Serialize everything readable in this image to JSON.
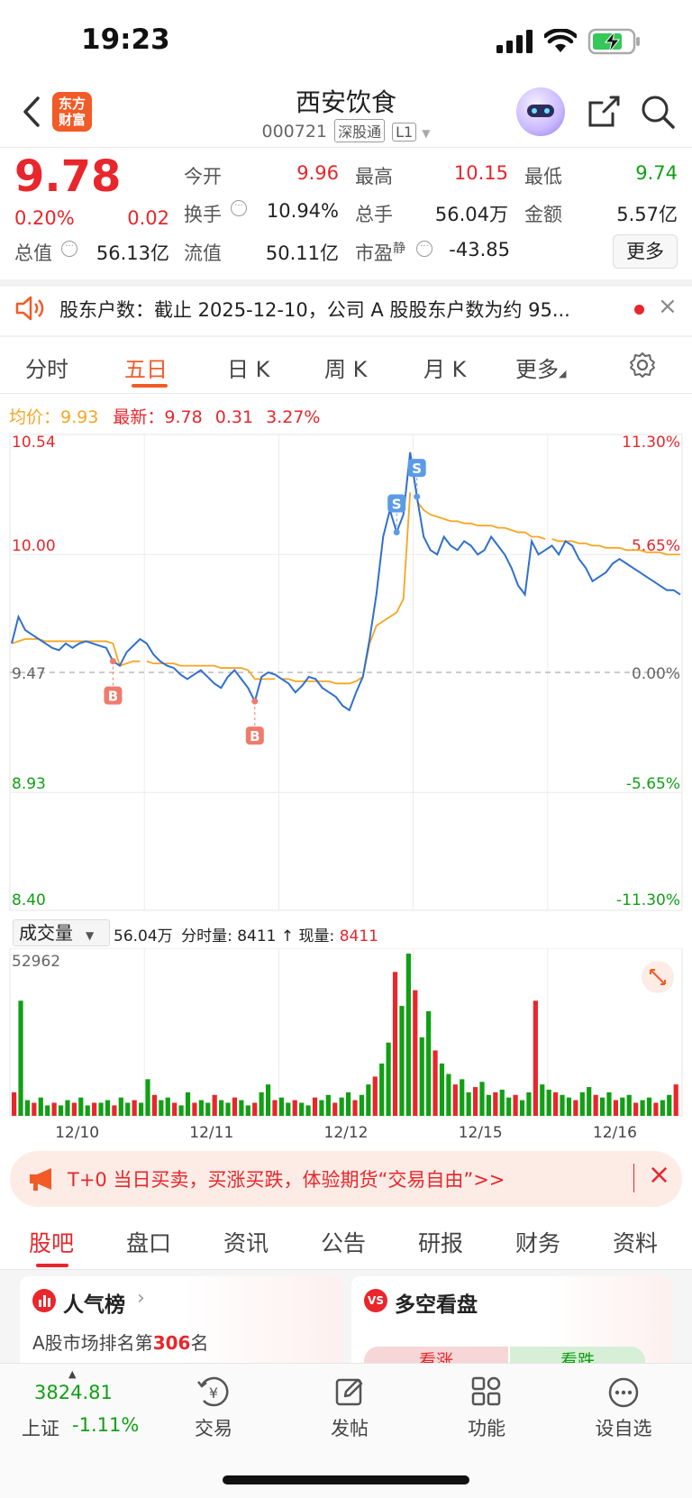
{
  "status_bar": {
    "time": "19:23"
  },
  "header": {
    "logo_text": "东方财富",
    "title": "西安饮食",
    "code": "000721",
    "tag1": "深股通",
    "tag2": "L1"
  },
  "quote": {
    "price": "9.78",
    "change_pct": "0.20%",
    "change": "0.02",
    "open_label": "今开",
    "open": "9.96",
    "high_label": "最高",
    "high": "10.15",
    "low_label": "最低",
    "low": "9.74",
    "turnover_label": "换手",
    "turnover": "10.94%",
    "volume_label": "总手",
    "volume": "56.04万",
    "amount_label": "金额",
    "amount": "5.57亿",
    "mcap_label": "总值",
    "mcap": "56.13亿",
    "float_label": "流值",
    "float": "50.11亿",
    "pe_label": "市盈",
    "pe_sup": "静",
    "pe": "-43.85",
    "more_label": "更多"
  },
  "notice": {
    "text": "股东户数：截止 2025-12-10，公司 A 股股东户数为约 95..."
  },
  "chart_tabs": [
    "分时",
    "五日",
    "日 K",
    "周 K",
    "月 K",
    "更多"
  ],
  "active_chart_tab": "五日",
  "chart_header": {
    "avg_label": "均价：",
    "avg": "9.93",
    "latest_label": "最新：",
    "latest": "9.78",
    "chg": "0.31",
    "chg_pct": "3.27%"
  },
  "chart_data": {
    "type": "line",
    "title": "",
    "y_ticks_left": [
      "10.54",
      "10.00",
      "9.47",
      "8.93",
      "8.40"
    ],
    "y_ticks_right": [
      "11.30%",
      "5.65%",
      "0.00%",
      "-5.65%",
      "-11.30%"
    ],
    "ylim": [
      8.4,
      10.54
    ],
    "prev_close": 9.47,
    "x_labels": [
      "12/10",
      "12/11",
      "12/12",
      "12/15",
      "12/16"
    ],
    "series": [
      {
        "values": [
          9.6,
          9.72,
          9.66,
          9.64,
          9.62,
          9.6,
          9.58,
          9.57,
          9.6,
          9.58,
          9.6,
          9.61,
          9.6,
          9.59,
          9.58,
          9.52,
          9.5,
          9.56,
          9.59,
          9.62,
          9.6,
          9.55,
          9.52,
          9.5,
          9.49,
          9.46,
          9.44,
          9.46,
          9.48,
          9.45,
          9.42,
          9.4,
          9.45,
          9.48,
          9.44,
          9.4,
          9.34,
          9.45,
          9.47,
          9.46,
          9.44,
          9.42,
          9.38,
          9.41,
          9.45,
          9.44,
          9.4,
          9.38,
          9.36,
          9.32,
          9.3,
          9.38,
          9.45,
          9.62,
          9.82,
          10.08,
          10.2,
          10.1,
          10.18,
          10.46,
          10.26,
          10.08,
          10.02,
          10.0,
          10.08,
          10.04,
          10.02,
          10.06,
          10.04,
          10.0,
          10.02,
          10.08,
          10.04,
          10.0,
          9.94,
          9.86,
          9.82,
          10.06,
          10.0,
          10.02,
          10.04,
          10.0,
          10.06,
          10.04,
          9.98,
          9.94,
          9.88,
          9.9,
          9.92,
          9.96,
          9.98,
          9.96,
          9.94,
          9.92,
          9.9,
          9.88,
          9.86,
          9.84,
          9.84,
          9.82
        ]
      },
      {
        "values": [
          9.6,
          9.61,
          9.62,
          9.62,
          9.62,
          9.61,
          9.61,
          9.61,
          9.61,
          9.61,
          9.61,
          9.61,
          9.61,
          9.61,
          9.61,
          9.6,
          9.5,
          9.51,
          9.52,
          9.52,
          9.52,
          9.51,
          9.51,
          9.51,
          9.51,
          9.5,
          9.5,
          9.5,
          9.5,
          9.5,
          9.5,
          9.49,
          9.49,
          9.49,
          9.49,
          9.48,
          9.44,
          9.44,
          9.44,
          9.44,
          9.44,
          9.44,
          9.43,
          9.43,
          9.43,
          9.43,
          9.43,
          9.43,
          9.42,
          9.42,
          9.42,
          9.43,
          9.45,
          9.6,
          9.68,
          9.7,
          9.72,
          9.74,
          9.8,
          10.28,
          10.24,
          10.2,
          10.18,
          10.17,
          10.16,
          10.15,
          10.15,
          10.14,
          10.14,
          10.13,
          10.13,
          10.13,
          10.12,
          10.12,
          10.11,
          10.1,
          10.1,
          10.08,
          10.08,
          10.07,
          10.07,
          10.06,
          10.06,
          10.06,
          10.05,
          10.05,
          10.04,
          10.04,
          10.03,
          10.03,
          10.03,
          10.02,
          10.02,
          10.02,
          10.01,
          10.01,
          10.01,
          10.0,
          10.0,
          10.0
        ]
      }
    ],
    "markers": [
      {
        "label": "B",
        "index": 15
      },
      {
        "label": "B",
        "index": 36
      },
      {
        "label": "S",
        "index": 57
      },
      {
        "label": "S",
        "index": 60
      }
    ]
  },
  "volume_header": {
    "selector": "成交量",
    "total": "56.04万",
    "tick_label": "分时量:",
    "tick_val": "8411",
    "now_label": "现量:",
    "now_val": "8411",
    "max": "52962"
  },
  "volume_data": [
    9,
    44,
    6,
    5,
    7,
    4,
    5,
    4,
    6,
    5,
    7,
    4,
    5,
    5,
    6,
    4,
    7,
    5,
    6,
    5,
    14,
    8,
    6,
    7,
    5,
    4,
    9,
    5,
    6,
    5,
    8,
    6,
    5,
    7,
    6,
    4,
    5,
    9,
    12,
    6,
    7,
    5,
    6,
    5,
    4,
    7,
    6,
    8,
    5,
    7,
    9,
    6,
    8,
    12,
    15,
    20,
    28,
    55,
    42,
    62,
    48,
    30,
    40,
    25,
    20,
    16,
    12,
    14,
    9,
    11,
    13,
    8,
    9,
    10,
    7,
    8,
    6,
    9,
    44,
    12,
    10,
    9,
    8,
    7,
    6,
    9,
    11,
    8,
    7,
    9,
    6,
    7,
    8,
    5,
    6,
    7,
    5,
    6,
    8,
    12
  ],
  "ad": {
    "text": "T+0 当日买卖，买涨买跌，体验期货“交易自由”>>"
  },
  "bottom_tabs": [
    "股吧",
    "盘口",
    "资讯",
    "公告",
    "研报",
    "财务",
    "资料"
  ],
  "active_bottom_tab": "股吧",
  "cards": {
    "left_title": "人气榜",
    "left_sub_prefix": "A股市场排名第",
    "left_rank": "306",
    "left_sub_suffix": "名",
    "right_title": "多空看盘",
    "bull": "看涨",
    "bear": "看跌"
  },
  "bottom_bar": {
    "index_value": "3824.81",
    "index_name": "上证",
    "index_change": "-1.11%",
    "items": [
      "交易",
      "发帖",
      "功能",
      "设自选"
    ]
  }
}
